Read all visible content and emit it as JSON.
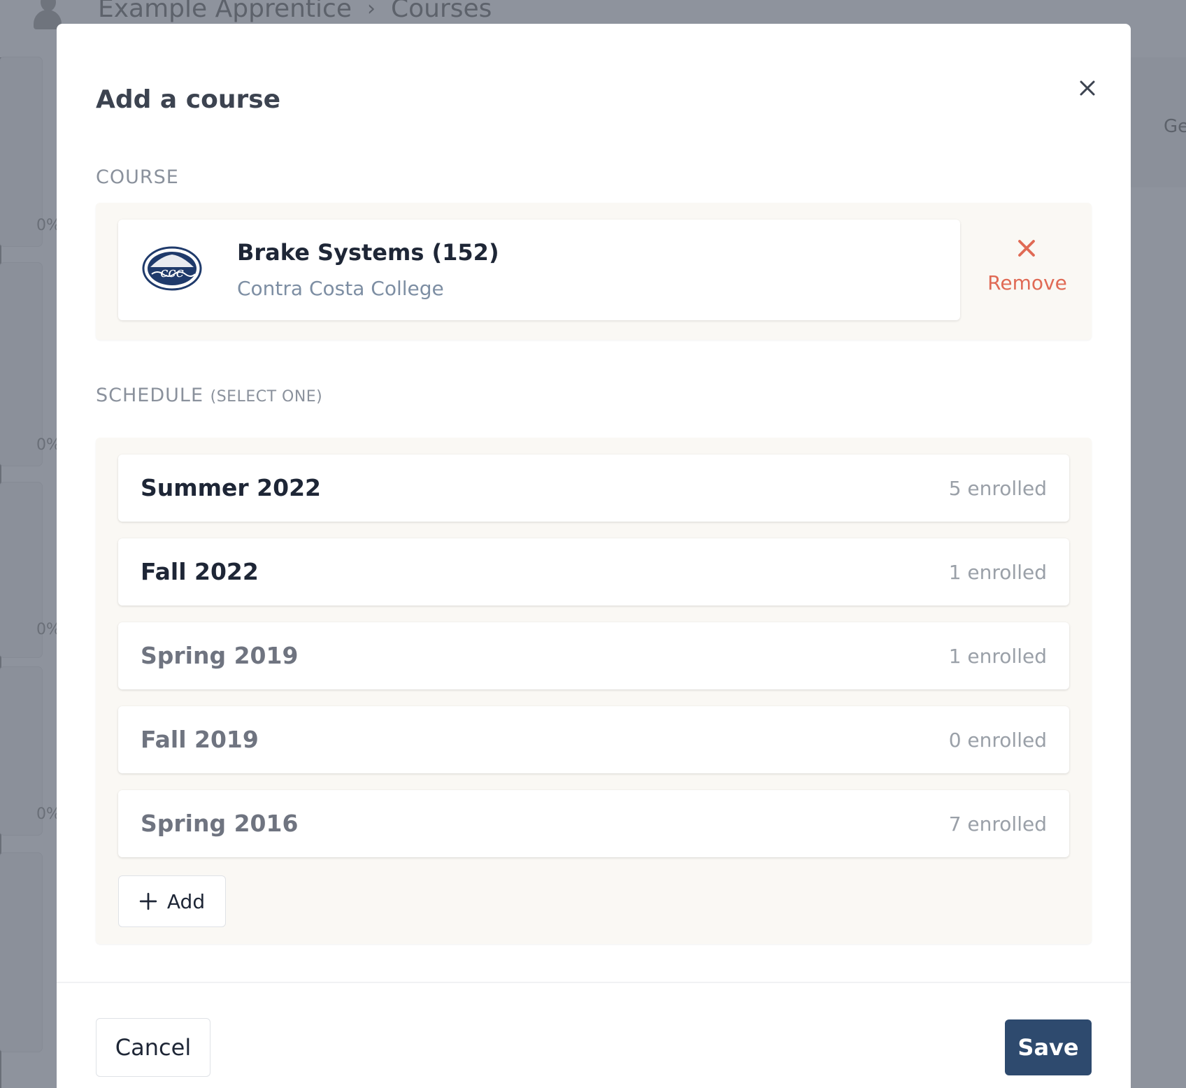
{
  "background": {
    "breadcrumb": [
      "Example Apprentice",
      "Courses"
    ],
    "breadcrumb_separator": "›",
    "progress_labels": [
      "0%",
      "0%",
      "0%",
      "0%"
    ],
    "right_panel_text": "Ge"
  },
  "modal": {
    "title": "Add a course",
    "course_section_label": "COURSE",
    "course": {
      "name": "Brake Systems (152)",
      "school": "Contra Costa College",
      "logo_text": "ccc",
      "remove_label": "Remove"
    },
    "schedule_section_label": "SCHEDULE",
    "schedule_section_hint": "(SELECT ONE)",
    "schedules": [
      {
        "term": "Summer 2022",
        "enrolled": "5 enrolled",
        "active": true
      },
      {
        "term": "Fall 2022",
        "enrolled": "1 enrolled",
        "active": true
      },
      {
        "term": "Spring 2019",
        "enrolled": "1 enrolled",
        "active": false
      },
      {
        "term": "Fall 2019",
        "enrolled": "0 enrolled",
        "active": false
      },
      {
        "term": "Spring 2016",
        "enrolled": "7 enrolled",
        "active": false
      }
    ],
    "add_label": "Add",
    "cancel_label": "Cancel",
    "save_label": "Save"
  },
  "colors": {
    "primary": "#2e4a6e",
    "danger": "#e06a55",
    "overlay": "#8e939d"
  }
}
